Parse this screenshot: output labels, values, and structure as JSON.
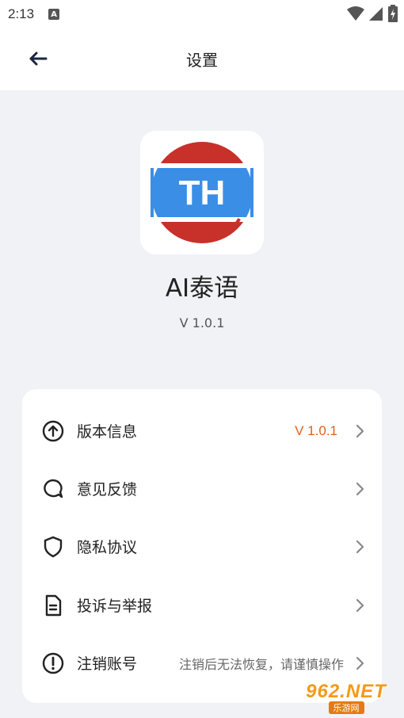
{
  "status_bar": {
    "time": "2:13",
    "notification_icon": "A"
  },
  "header": {
    "title": "设置"
  },
  "app": {
    "logo_text": "TH",
    "name": "AI泰语",
    "version": "V 1.0.1"
  },
  "menu": {
    "items": [
      {
        "label": "版本信息",
        "value": "V 1.0.1",
        "icon": "arrow-up-circle-icon"
      },
      {
        "label": "意见反馈",
        "icon": "chat-bubble-icon"
      },
      {
        "label": "隐私协议",
        "icon": "shield-icon"
      },
      {
        "label": "投诉与举报",
        "icon": "document-icon"
      },
      {
        "label": "注销账号",
        "note": "注销后无法恢复，请谨慎操作",
        "icon": "exclamation-circle-icon"
      }
    ]
  },
  "watermark": {
    "main": "962.NET",
    "sub": "乐游网"
  },
  "colors": {
    "accent_value": "#e2601b",
    "logo_red": "#c8302a",
    "logo_blue": "#3b8ee6"
  }
}
